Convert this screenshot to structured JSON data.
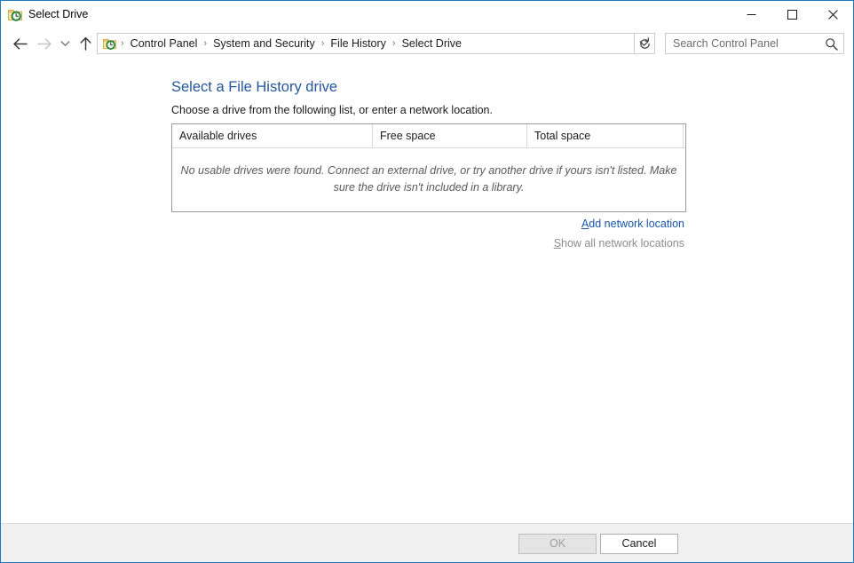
{
  "window": {
    "title": "Select Drive",
    "icon": "file-history-folder-icon",
    "accent_color": "#1f7bc1",
    "controls": {
      "minimize": "—",
      "maximize": "☐",
      "close": "✕"
    }
  },
  "navbar": {
    "back_icon": "back-arrow-icon",
    "forward_icon": "forward-arrow-icon",
    "recent_icon": "chevron-down-icon",
    "up_icon": "up-arrow-icon",
    "address_icon": "file-history-folder-icon",
    "breadcrumbs": [
      {
        "label": "Control Panel"
      },
      {
        "label": "System and Security"
      },
      {
        "label": "File History"
      },
      {
        "label": "Select Drive"
      }
    ],
    "separator": "›",
    "dropdown_icon": "chevron-down-icon",
    "refresh_icon": "refresh-icon",
    "search": {
      "placeholder": "Search Control Panel",
      "value": "",
      "icon": "search-icon"
    }
  },
  "main": {
    "heading": "Select a File History drive",
    "subtitle": "Choose a drive from the following list, or enter a network location.",
    "heading_color": "#25569b",
    "table": {
      "columns": [
        {
          "label": "Available drives"
        },
        {
          "label": "Free space"
        },
        {
          "label": "Total space"
        }
      ],
      "rows": [],
      "empty_message": "No usable drives were found. Connect an external drive, or try another drive if yours isn't listed. Make sure the drive isn't included in a library."
    },
    "links": [
      {
        "name": "add-network-location-link",
        "accelerator": "A",
        "rest": "dd network location",
        "enabled": true,
        "color": "#1756a9"
      },
      {
        "name": "show-all-network-locations-link",
        "accelerator": "S",
        "rest": "how all network locations",
        "enabled": false,
        "color": "#8d8d8d"
      }
    ]
  },
  "footer": {
    "ok_label": "OK",
    "ok_enabled": false,
    "cancel_label": "Cancel",
    "cancel_enabled": true
  }
}
